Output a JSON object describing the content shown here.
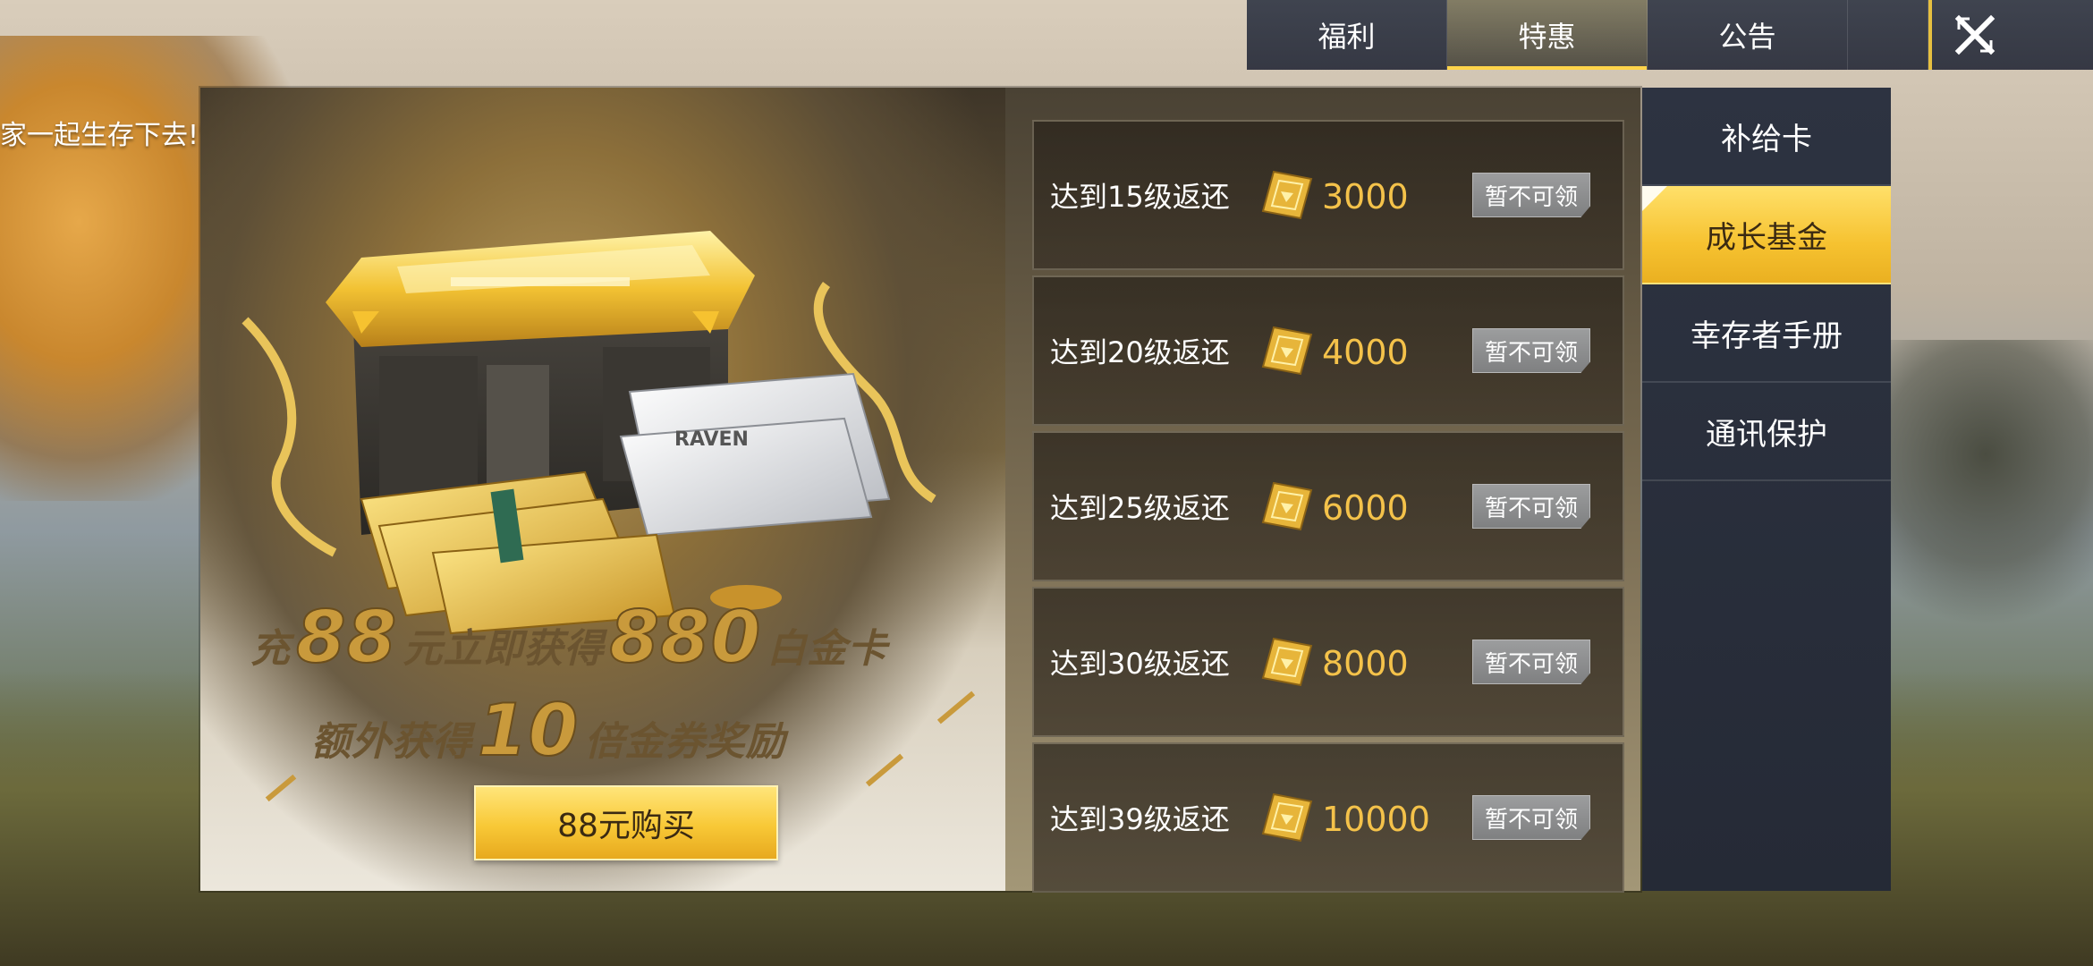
{
  "background": {
    "quote_text": "家一起生存下去!\""
  },
  "top_tabs": [
    {
      "label": "福利",
      "active": false
    },
    {
      "label": "特惠",
      "active": true
    },
    {
      "label": "公告",
      "active": false
    }
  ],
  "close_icon": "close-x-icon",
  "promo": {
    "line1_prefix": "充",
    "line1_amount": "88",
    "line1_middle": "元立即获得",
    "line1_reward": "880",
    "line1_suffix": "白金卡",
    "line2_prefix": "额外获得",
    "line2_multiplier": "10",
    "line2_suffix": "倍金券奖励",
    "card_text": "RAVEN",
    "buy_button_label": "88元购买"
  },
  "rewards": [
    {
      "label": "达到15级返还",
      "amount": "3000",
      "button": "暂不可领"
    },
    {
      "label": "达到20级返还",
      "amount": "4000",
      "button": "暂不可领"
    },
    {
      "label": "达到25级返还",
      "amount": "6000",
      "button": "暂不可领"
    },
    {
      "label": "达到30级返还",
      "amount": "8000",
      "button": "暂不可领"
    },
    {
      "label": "达到39级返还",
      "amount": "10000",
      "button": "暂不可领"
    }
  ],
  "side_menu": [
    {
      "label": "补给卡",
      "active": false
    },
    {
      "label": "成长基金",
      "active": true
    },
    {
      "label": "幸存者手册",
      "active": false
    },
    {
      "label": "通讯保护",
      "active": false
    }
  ],
  "colors": {
    "accent_gold": "#f6c230",
    "amount_gold": "#f4c24a",
    "menu_dark": "#2d3341",
    "disabled_button": "#8e8f90"
  }
}
